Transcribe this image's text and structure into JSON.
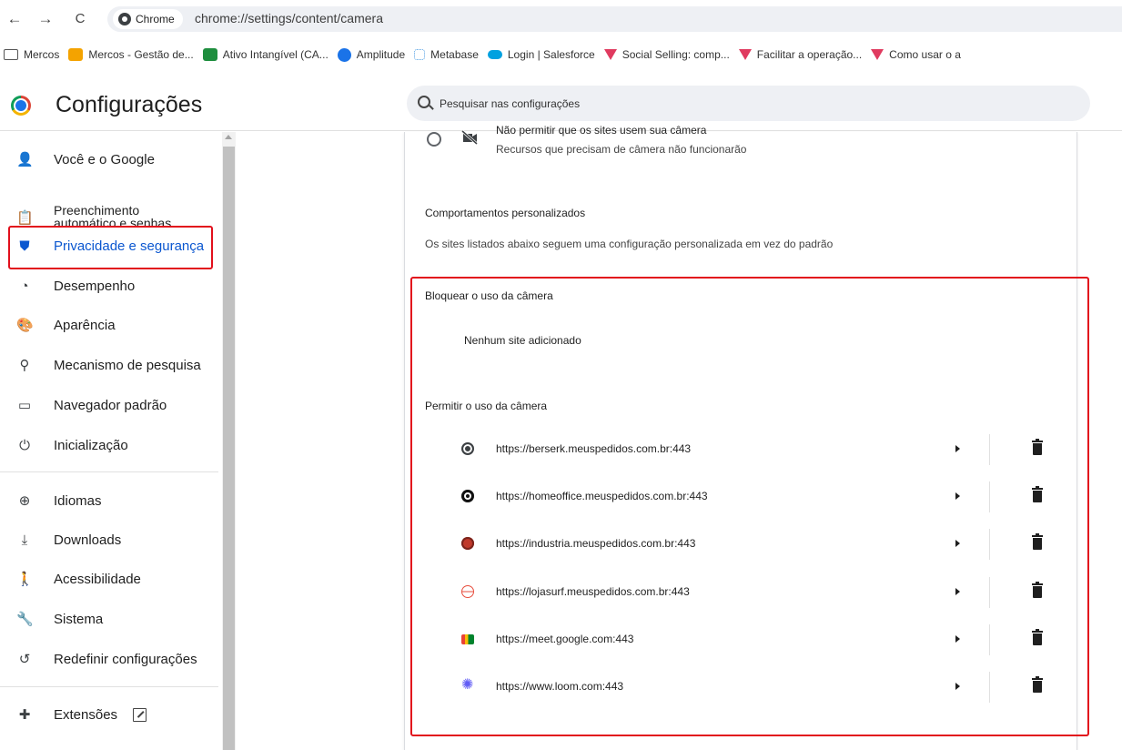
{
  "toolbar": {
    "back": "←",
    "forward": "→",
    "reload": "C",
    "chip_label": "Chrome",
    "url": "chrome://settings/content/camera"
  },
  "bookmarks": [
    {
      "label": "Mercos",
      "icon": "folder-icon",
      "color": "#555555"
    },
    {
      "label": "Mercos - Gestão de...",
      "icon": "app-icon",
      "color": "#f4a300"
    },
    {
      "label": "Ativo Intangível (CA...",
      "icon": "sheets-icon",
      "color": "#1e8e3e"
    },
    {
      "label": "Amplitude",
      "icon": "amplitude-icon",
      "color": "#1a73e8"
    },
    {
      "label": "Metabase",
      "icon": "metabase-icon",
      "color": "#509ee3"
    },
    {
      "label": "Login | Salesforce",
      "icon": "cloud-icon",
      "color": "#00a1e0"
    },
    {
      "label": "Social Selling: comp...",
      "icon": "triangle-icon",
      "color": "#e03a5f"
    },
    {
      "label": "Facilitar a operação...",
      "icon": "triangle-icon",
      "color": "#e03a5f"
    },
    {
      "label": "Como usar o a",
      "icon": "triangle-icon",
      "color": "#e03a5f"
    }
  ],
  "header": {
    "title": "Configurações",
    "search_placeholder": "Pesquisar nas configurações"
  },
  "sidebar": {
    "items": [
      {
        "label": "Você e o Google",
        "icon": "person-icon",
        "glyph": "👤"
      },
      {
        "label": "Preenchimento automático e senhas",
        "line1": "Preenchimento",
        "line2": "automático e senhas",
        "icon": "clipboard-icon",
        "glyph": "📋"
      },
      {
        "label": "Privacidade e segurança",
        "icon": "shield-icon",
        "glyph": "⛊",
        "active": true
      },
      {
        "label": "Desempenho",
        "icon": "speedometer-icon",
        "glyph": "◔"
      },
      {
        "label": "Aparência",
        "icon": "palette-icon",
        "glyph": "🎨"
      },
      {
        "label": "Mecanismo de pesquisa",
        "icon": "search-icon",
        "glyph": "⚲"
      },
      {
        "label": "Navegador padrão",
        "icon": "browser-icon",
        "glyph": "▭"
      },
      {
        "label": "Inicialização",
        "icon": "power-icon",
        "glyph": "⏻"
      },
      {
        "label": "Idiomas",
        "icon": "globe-icon",
        "glyph": "⊕"
      },
      {
        "label": "Downloads",
        "icon": "download-icon",
        "glyph": "⤓"
      },
      {
        "label": "Acessibilidade",
        "icon": "accessibility-icon",
        "glyph": "🚶"
      },
      {
        "label": "Sistema",
        "icon": "wrench-icon",
        "glyph": "🔧"
      },
      {
        "label": "Redefinir configurações",
        "icon": "history-icon",
        "glyph": "↺"
      },
      {
        "label": "Extensões",
        "icon": "puzzle-icon",
        "glyph": "✚"
      }
    ],
    "active_color": "#0b57d0"
  },
  "main": {
    "block_option_cut": "Não permitir que os sites usem sua câmera",
    "block_option_desc": "Recursos que precisam de câmera não funcionarão",
    "custom_title": "Comportamentos personalizados",
    "custom_desc": "Os sites listados abaixo seguem uma configuração personalizada em vez do padrão",
    "block_label": "Bloquear o uso da câmera",
    "block_empty": "Nenhum site adicionado",
    "allow_label": "Permitir o uso da câmera",
    "allowed_sites": [
      {
        "url": "https://berserk.meuspedidos.com.br:443",
        "favicon": "globe-icon",
        "color": "#3c4043"
      },
      {
        "url": "https://homeoffice.meuspedidos.com.br:443",
        "favicon": "dark-logo-icon",
        "color": "#111111"
      },
      {
        "url": "https://industria.meuspedidos.com.br:443",
        "favicon": "red-logo-icon",
        "color": "#c0392b"
      },
      {
        "url": "https://lojasurf.meuspedidos.com.br:443",
        "favicon": "lojasurf-icon",
        "color": "#e74c3c"
      },
      {
        "url": "https://meet.google.com:443",
        "favicon": "meet-icon",
        "color": "#00832d"
      },
      {
        "url": "https://www.loom.com:443",
        "favicon": "loom-icon",
        "color": "#625df5"
      }
    ]
  },
  "highlight_color": "#e2101c"
}
